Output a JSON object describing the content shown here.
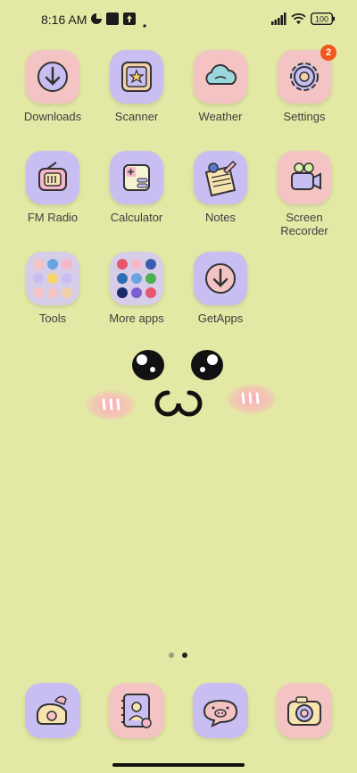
{
  "status_bar": {
    "time": "8:16 AM",
    "battery": "100",
    "icons": [
      "notification-icon",
      "square-icon",
      "upload-box-icon",
      "dot-icon",
      "signal-icon",
      "wifi-icon",
      "battery-icon"
    ]
  },
  "apps": [
    {
      "label": "Downloads",
      "icon": "download-arrow-icon"
    },
    {
      "label": "Scanner",
      "icon": "scanner-star-icon"
    },
    {
      "label": "Weather",
      "icon": "cloud-icon"
    },
    {
      "label": "Settings",
      "icon": "gear-icon",
      "badge": "2"
    },
    {
      "label": "FM Radio",
      "icon": "radio-icon"
    },
    {
      "label": "Calculator",
      "icon": "calculator-icon"
    },
    {
      "label": "Notes",
      "icon": "notepad-icon"
    },
    {
      "label": "Screen Recorder",
      "label_line1": "Screen",
      "label_line2": "Recorder",
      "icon": "video-camera-icon"
    },
    {
      "label": "Tools",
      "icon": "folder-icon"
    },
    {
      "label": "More apps",
      "icon": "folder-icon"
    },
    {
      "label": "GetApps",
      "icon": "download-arrow-icon"
    }
  ],
  "dock": [
    {
      "icon": "telephone-icon"
    },
    {
      "icon": "contacts-book-icon"
    },
    {
      "icon": "pig-message-icon"
    },
    {
      "icon": "camera-icon"
    }
  ],
  "page_indicator": {
    "pages": 2,
    "current": 2
  },
  "colors": {
    "background": "#e3e8a5",
    "pink_tile": "#f4c3c3",
    "purple_tile": "#c8bef2",
    "badge": "#f2561d"
  }
}
